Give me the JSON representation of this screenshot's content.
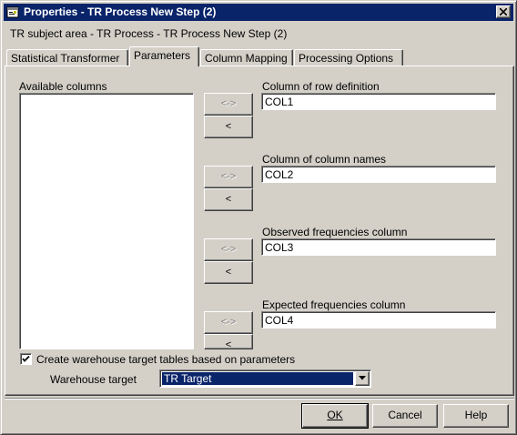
{
  "window": {
    "title": "Properties - TR Process New Step (2)"
  },
  "subject_line": "TR subject area - TR Process - TR Process New Step (2)",
  "tabs": [
    {
      "label": "Statistical Transformer",
      "active": false
    },
    {
      "label": "Parameters",
      "active": true
    },
    {
      "label": "Column Mapping",
      "active": false
    },
    {
      "label": "Processing Options",
      "active": false
    }
  ],
  "parameters": {
    "available_columns_label": "Available columns",
    "swap_button_label": "<->",
    "add_button_label": "<",
    "fields": [
      {
        "label": "Column of row definition",
        "value": "COL1"
      },
      {
        "label": "Column of column names",
        "value": "COL2"
      },
      {
        "label": "Observed frequencies column",
        "value": "COL3"
      },
      {
        "label": "Expected frequencies column",
        "value": "COL4"
      }
    ],
    "create_tables_label": "Create warehouse target tables based on parameters",
    "create_tables_checked": true,
    "warehouse_target_label": "Warehouse target",
    "warehouse_target_value": "TR Target"
  },
  "buttons": {
    "ok": "OK",
    "cancel": "Cancel",
    "help": "Help"
  },
  "icons": {
    "window": "properties-window-icon",
    "close": "close-icon",
    "check": "checkmark-icon",
    "dropdown": "chevron-down-icon"
  },
  "colors": {
    "titlebar": "#0a246a",
    "face": "#d4d0c8",
    "selection": "#0a246a"
  }
}
